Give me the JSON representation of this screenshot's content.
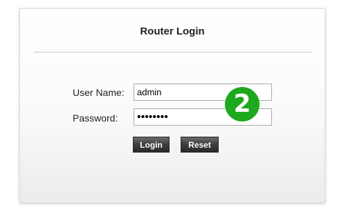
{
  "login": {
    "title": "Router Login",
    "username_label": "User Name:",
    "username_value": "admin",
    "password_label": "Password:",
    "password_value": "********",
    "login_button": "Login",
    "reset_button": "Reset"
  },
  "overlay": {
    "step_number": "2",
    "badge_color": "#1ea81e"
  }
}
